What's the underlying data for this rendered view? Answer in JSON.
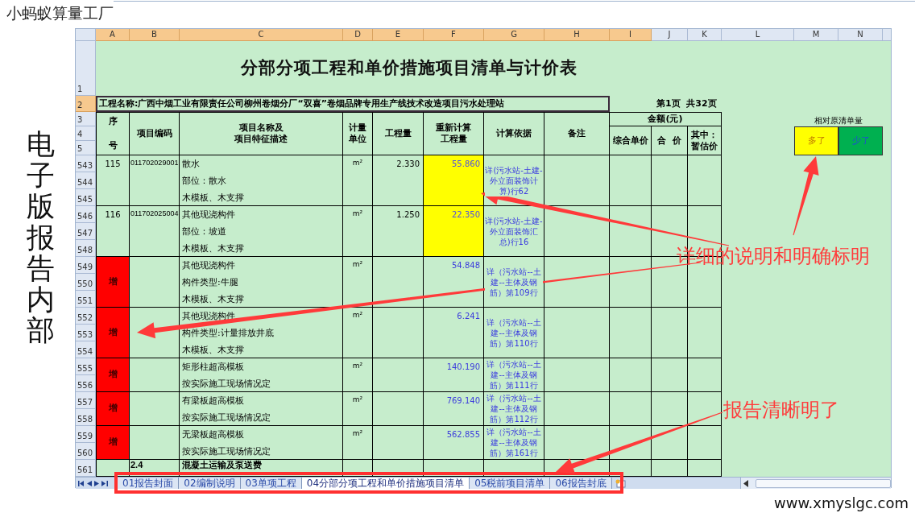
{
  "slide_title": "小蚂蚁算量工厂",
  "side_caption": "电子版报告内部",
  "spreadsheet": {
    "columns": [
      {
        "label": "A",
        "selected": true
      },
      {
        "label": "B",
        "selected": true
      },
      {
        "label": "C",
        "selected": true
      },
      {
        "label": "D",
        "selected": true
      },
      {
        "label": "E",
        "selected": true
      },
      {
        "label": "F",
        "selected": true
      },
      {
        "label": "G",
        "selected": true
      },
      {
        "label": "H",
        "selected": true
      },
      {
        "label": "I",
        "selected": true
      },
      {
        "label": "J",
        "selected": false
      },
      {
        "label": "K",
        "selected": false
      },
      {
        "label": "L",
        "selected": false
      },
      {
        "label": "M",
        "selected": false
      },
      {
        "label": "N",
        "selected": false
      }
    ],
    "rows": [
      {
        "label": "1",
        "selected": false
      },
      {
        "label": "2",
        "selected": true
      },
      {
        "label": "3",
        "selected": false
      },
      {
        "label": "4",
        "selected": false
      },
      {
        "label": "5",
        "selected": false
      },
      {
        "label": "543",
        "selected": false
      },
      {
        "label": "544",
        "selected": false
      },
      {
        "label": "545",
        "selected": false
      },
      {
        "label": "546",
        "selected": false
      },
      {
        "label": "547",
        "selected": false
      },
      {
        "label": "548",
        "selected": false
      },
      {
        "label": "549",
        "selected": false
      },
      {
        "label": "550",
        "selected": false
      },
      {
        "label": "551",
        "selected": false
      },
      {
        "label": "552",
        "selected": false
      },
      {
        "label": "553",
        "selected": false
      },
      {
        "label": "554",
        "selected": false
      },
      {
        "label": "555",
        "selected": false
      },
      {
        "label": "556",
        "selected": false
      },
      {
        "label": "557",
        "selected": false
      },
      {
        "label": "558",
        "selected": false
      },
      {
        "label": "559",
        "selected": false
      },
      {
        "label": "560",
        "selected": false
      },
      {
        "label": "561",
        "selected": false
      }
    ],
    "title": "分部分项工程和单价措施项目清单与计价表",
    "project_name": "工程名称:广西中烟工业有限责任公司柳州卷烟分厂“双喜”卷烟品牌专用生产线技术改造项目污水处理站",
    "page_info": "第1页  共32页",
    "headers": {
      "seq": "序号",
      "code": "项目编码",
      "name": [
        "项目名称及",
        "项目特征描述"
      ],
      "unit": "计量单位",
      "quantity": "工程量",
      "recalculated": [
        "重新计算",
        "工程量"
      ],
      "basis": "计算依据",
      "remarks": "备注",
      "amount": "金额(元)",
      "unit_price": "综合单价",
      "total": "合  价",
      "provisional": [
        "其中：",
        "暂估价"
      ]
    },
    "legend": {
      "title": "相对原清单量",
      "items": [
        {
          "label": "多了",
          "color": "#ffff00"
        },
        {
          "label": "少了",
          "color": "#00b050"
        }
      ]
    },
    "items": [
      {
        "kind": "revised",
        "seq": "115",
        "code": "011702029001",
        "lines": [
          "散水",
          "部位：散水",
          "木模板、木支撑"
        ],
        "unit": "m²",
        "quantity": "2.330",
        "recalculated": "55.860",
        "color": "#ffff00",
        "basis": "详(污水站-土建-外立面装饰计算)行62"
      },
      {
        "kind": "revised",
        "seq": "116",
        "code": "011702025004",
        "lines": [
          "其他现浇构件",
          "部位：坡道",
          "木模板、木支撑"
        ],
        "unit": "m²",
        "quantity": "1.250",
        "recalculated": "22.350",
        "color": "#ffff00",
        "basis": "详(污水站-土建-外立面装饰汇总)行16"
      },
      {
        "kind": "added",
        "mark": "增",
        "lines": [
          "其他现浇构件",
          "构件类型:牛腿",
          "木模板、木支撑"
        ],
        "unit": "m²",
        "recalculated": "54.848",
        "color": "#ff0000",
        "basis": "详（污水站--土建--主体及钢筋）第109行"
      },
      {
        "kind": "added",
        "mark": "增",
        "lines": [
          "其他现浇构件",
          "构件类型:计量排放井底",
          "木模板、木支撑"
        ],
        "unit": "m²",
        "recalculated": "6.241",
        "color": "#ff0000",
        "basis": "详（污水站--土建--主体及钢筋）第110行"
      },
      {
        "kind": "added",
        "mark": "增",
        "lines": [
          "矩形柱超高模板",
          "按实际施工现场情况定"
        ],
        "unit": "m²",
        "recalculated": "140.190",
        "color": "#ff0000",
        "basis": "详（污水站--土建--主体及钢筋）第111行"
      },
      {
        "kind": "added",
        "mark": "增",
        "lines": [
          "有梁板超高模板",
          "按实际施工现场情况定"
        ],
        "unit": "m²",
        "recalculated": "769.140",
        "color": "#ff0000",
        "basis": "详（污水站--土建--主体及钢筋）第112行"
      },
      {
        "kind": "added",
        "mark": "增",
        "lines": [
          "无梁板超高模板",
          "按实际施工现场情况定"
        ],
        "unit": "m²",
        "recalculated": "562.855",
        "color": "#ff0000",
        "basis": "详（污水站--土建--主体及钢筋）第161行"
      },
      {
        "kind": "section",
        "code": "2.4",
        "lines": [
          "混凝土运输及泵送费"
        ]
      }
    ],
    "sheet_tabs": [
      {
        "label": "01报告封面",
        "selected": false
      },
      {
        "label": "02编制说明",
        "selected": false
      },
      {
        "label": "03单项工程",
        "selected": false
      },
      {
        "label": "04分部分项工程和单价措施项目清单",
        "selected": true
      },
      {
        "label": "05税前项目清单",
        "selected": false
      },
      {
        "label": "06报告封底",
        "selected": false
      }
    ]
  },
  "callouts": [
    {
      "text": "详细的说明和明确标明"
    },
    {
      "text": "报告清晰明了"
    }
  ],
  "footer_url": "www.xmyslgc.com"
}
